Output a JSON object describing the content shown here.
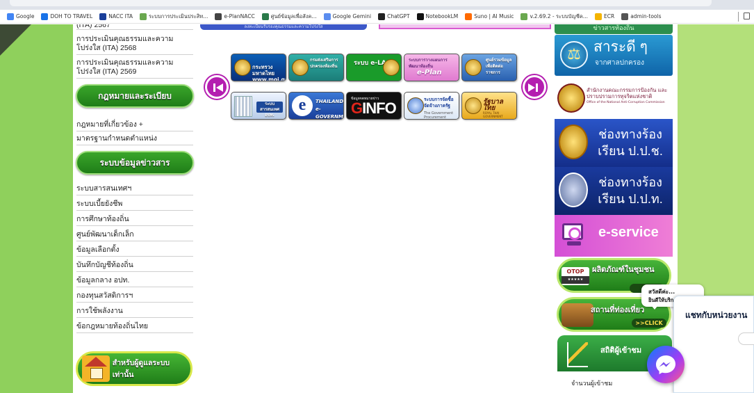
{
  "bookmarks": [
    {
      "label": "Google",
      "icon": "google-icon",
      "color": "#4285f4"
    },
    {
      "label": "DOH TO TRAVEL",
      "icon": "doh-icon",
      "color": "#1a73e8"
    },
    {
      "label": "NACC ITA",
      "icon": "nacc-icon",
      "color": "#1a3f9a"
    },
    {
      "label": "ระบบการประเมินประสิท...",
      "icon": "gov-seal-icon",
      "color": "#6aa84f"
    },
    {
      "label": "e-PlanNACC",
      "icon": "home-icon",
      "color": "#444444"
    },
    {
      "label": "ศูนย์ข้อมูลเพื่อสังค...",
      "icon": "data-center-icon",
      "color": "#2a7a4a"
    },
    {
      "label": "Google Gemini",
      "icon": "gemini-icon",
      "color": "#5b8def"
    },
    {
      "label": "ChatGPT",
      "icon": "chatgpt-icon",
      "color": "#222222"
    },
    {
      "label": "NotebookLM",
      "icon": "notebooklm-icon",
      "color": "#111111"
    },
    {
      "label": "Suno | AI Music",
      "icon": "suno-icon",
      "color": "#ff6a00"
    },
    {
      "label": "v.2.69.2 - ระบบบัญชีค...",
      "icon": "gov-seal-icon",
      "color": "#6aa84f"
    },
    {
      "label": "ECR",
      "icon": "ecr-icon",
      "color": "#f4b400"
    },
    {
      "label": "admin-tools",
      "icon": "globe-icon",
      "color": "#555555"
    }
  ],
  "sidebar": {
    "links_top": [
      {
        "label": "(ITA) 2567"
      },
      {
        "label": "การประเมินคุณธรรมและความโปร่งใส (ITA) 2568"
      },
      {
        "label": "การประเมินคุณธรรมและความโปร่งใส (ITA) 2569"
      }
    ],
    "section_law": "กฎหมายและระเบียบ",
    "links_law": [
      {
        "label": "กฎหมายที่เกี่ยวข้อง +"
      },
      {
        "label": "มาตรฐานกำหนดตำแหน่ง"
      }
    ],
    "section_info": "ระบบข้อมูลข่าวสาร",
    "links_info": [
      {
        "label": "ระบบสารสนเทศฯ"
      },
      {
        "label": "ระบบเบี้ยยังชีพ"
      },
      {
        "label": "การศึกษาท้องถิ่น"
      },
      {
        "label": "ศูนย์พัฒนาเด็กเล็ก"
      },
      {
        "label": "ข้อมูลเลือกตั้ง"
      },
      {
        "label": "บันทึกบัญชีท้องถิ่น"
      },
      {
        "label": "ข้อมูลกลาง อปท."
      },
      {
        "label": "กองทุนสวัสดิการฯ"
      },
      {
        "label": "การใช้พลังงาน"
      },
      {
        "label": "ข้อกฎหมายท้องถิ่นไทย"
      }
    ],
    "bottom_button": "สำหรับผู้ดูแลระบบเท่านั้น"
  },
  "banners_top": {
    "left_text": "ลงทะเบียนรับรองคุณธรรมและความโปร่งใส"
  },
  "slider": {
    "tiles": [
      {
        "text": "กระทรวงมหาดไทย www.moi.go.th"
      },
      {
        "text": "กรมส่งเสริมการปกครองท้องถิ่น"
      },
      {
        "text": "ระบบ e-LAAS"
      },
      {
        "text": "ระบบการวางแผนการพัฒนาท้องถิ่น",
        "big": "e-Plan"
      },
      {
        "text": "ศูนย์รวมข้อมูลเพื่อติดต่อราชการ"
      },
      {
        "text": "ระบบสารสนเทศ อปท."
      },
      {
        "text": "THAILAND e-GOVERNMENT",
        "big": "e"
      },
      {
        "text": "ข้อมูลจดหมายข่าว",
        "big_prefix": "G",
        "big_rest": "INFO"
      },
      {
        "text": "ระบบการจัดซื้อจัดจ้างภาครัฐ",
        "sub": "The Government Procurement"
      },
      {
        "text": "รัฐบาลไทย",
        "sub": "ROYAL THAI GOVERNMENT"
      }
    ]
  },
  "right": {
    "top_label": "ข่าวสารท้องถิ่น",
    "saradee_title": "สาระดี ๆ",
    "saradee_sub": "จากศาลปกครอง",
    "nacc_line1": "สำนักงานคณะกรรมการป้องกัน และปราบปรามการทุจริตแห่งชาติ",
    "nacc_line2": "Office of the National Anti-Corruption Commission",
    "pch_title": "ช่องทางร้องเรียน ป.ป.ช.",
    "ppt_title": "ช่องทางร้องเรียน ป.ป.ท.",
    "eservice": "e-service",
    "otop_badge": "OTOP",
    "otop_stars": "★★★★★",
    "otop_title": "ผลิตภัณฑ์ในชุมชน",
    "click": ">>CLICK",
    "click_short": ">>",
    "travel_title": "สถานที่ท่องเที่ยว",
    "stats_title": "สถิติผู้เข้าชม",
    "stats_count": "จำนวนผู้เข้าชม"
  },
  "chat": {
    "greeting_line1": "สวัสดีค่ะ...",
    "greeting_line2": "ยินดีให้บริการค่ะ",
    "panel_title": "แชทกับหน่วยงาน"
  },
  "colors": {
    "page_background": "#b3e07a",
    "sidebar_header": "#1f7d18",
    "slider_arrow": "#b41eb0",
    "messenger_gradient_start": "#0a7cff"
  }
}
